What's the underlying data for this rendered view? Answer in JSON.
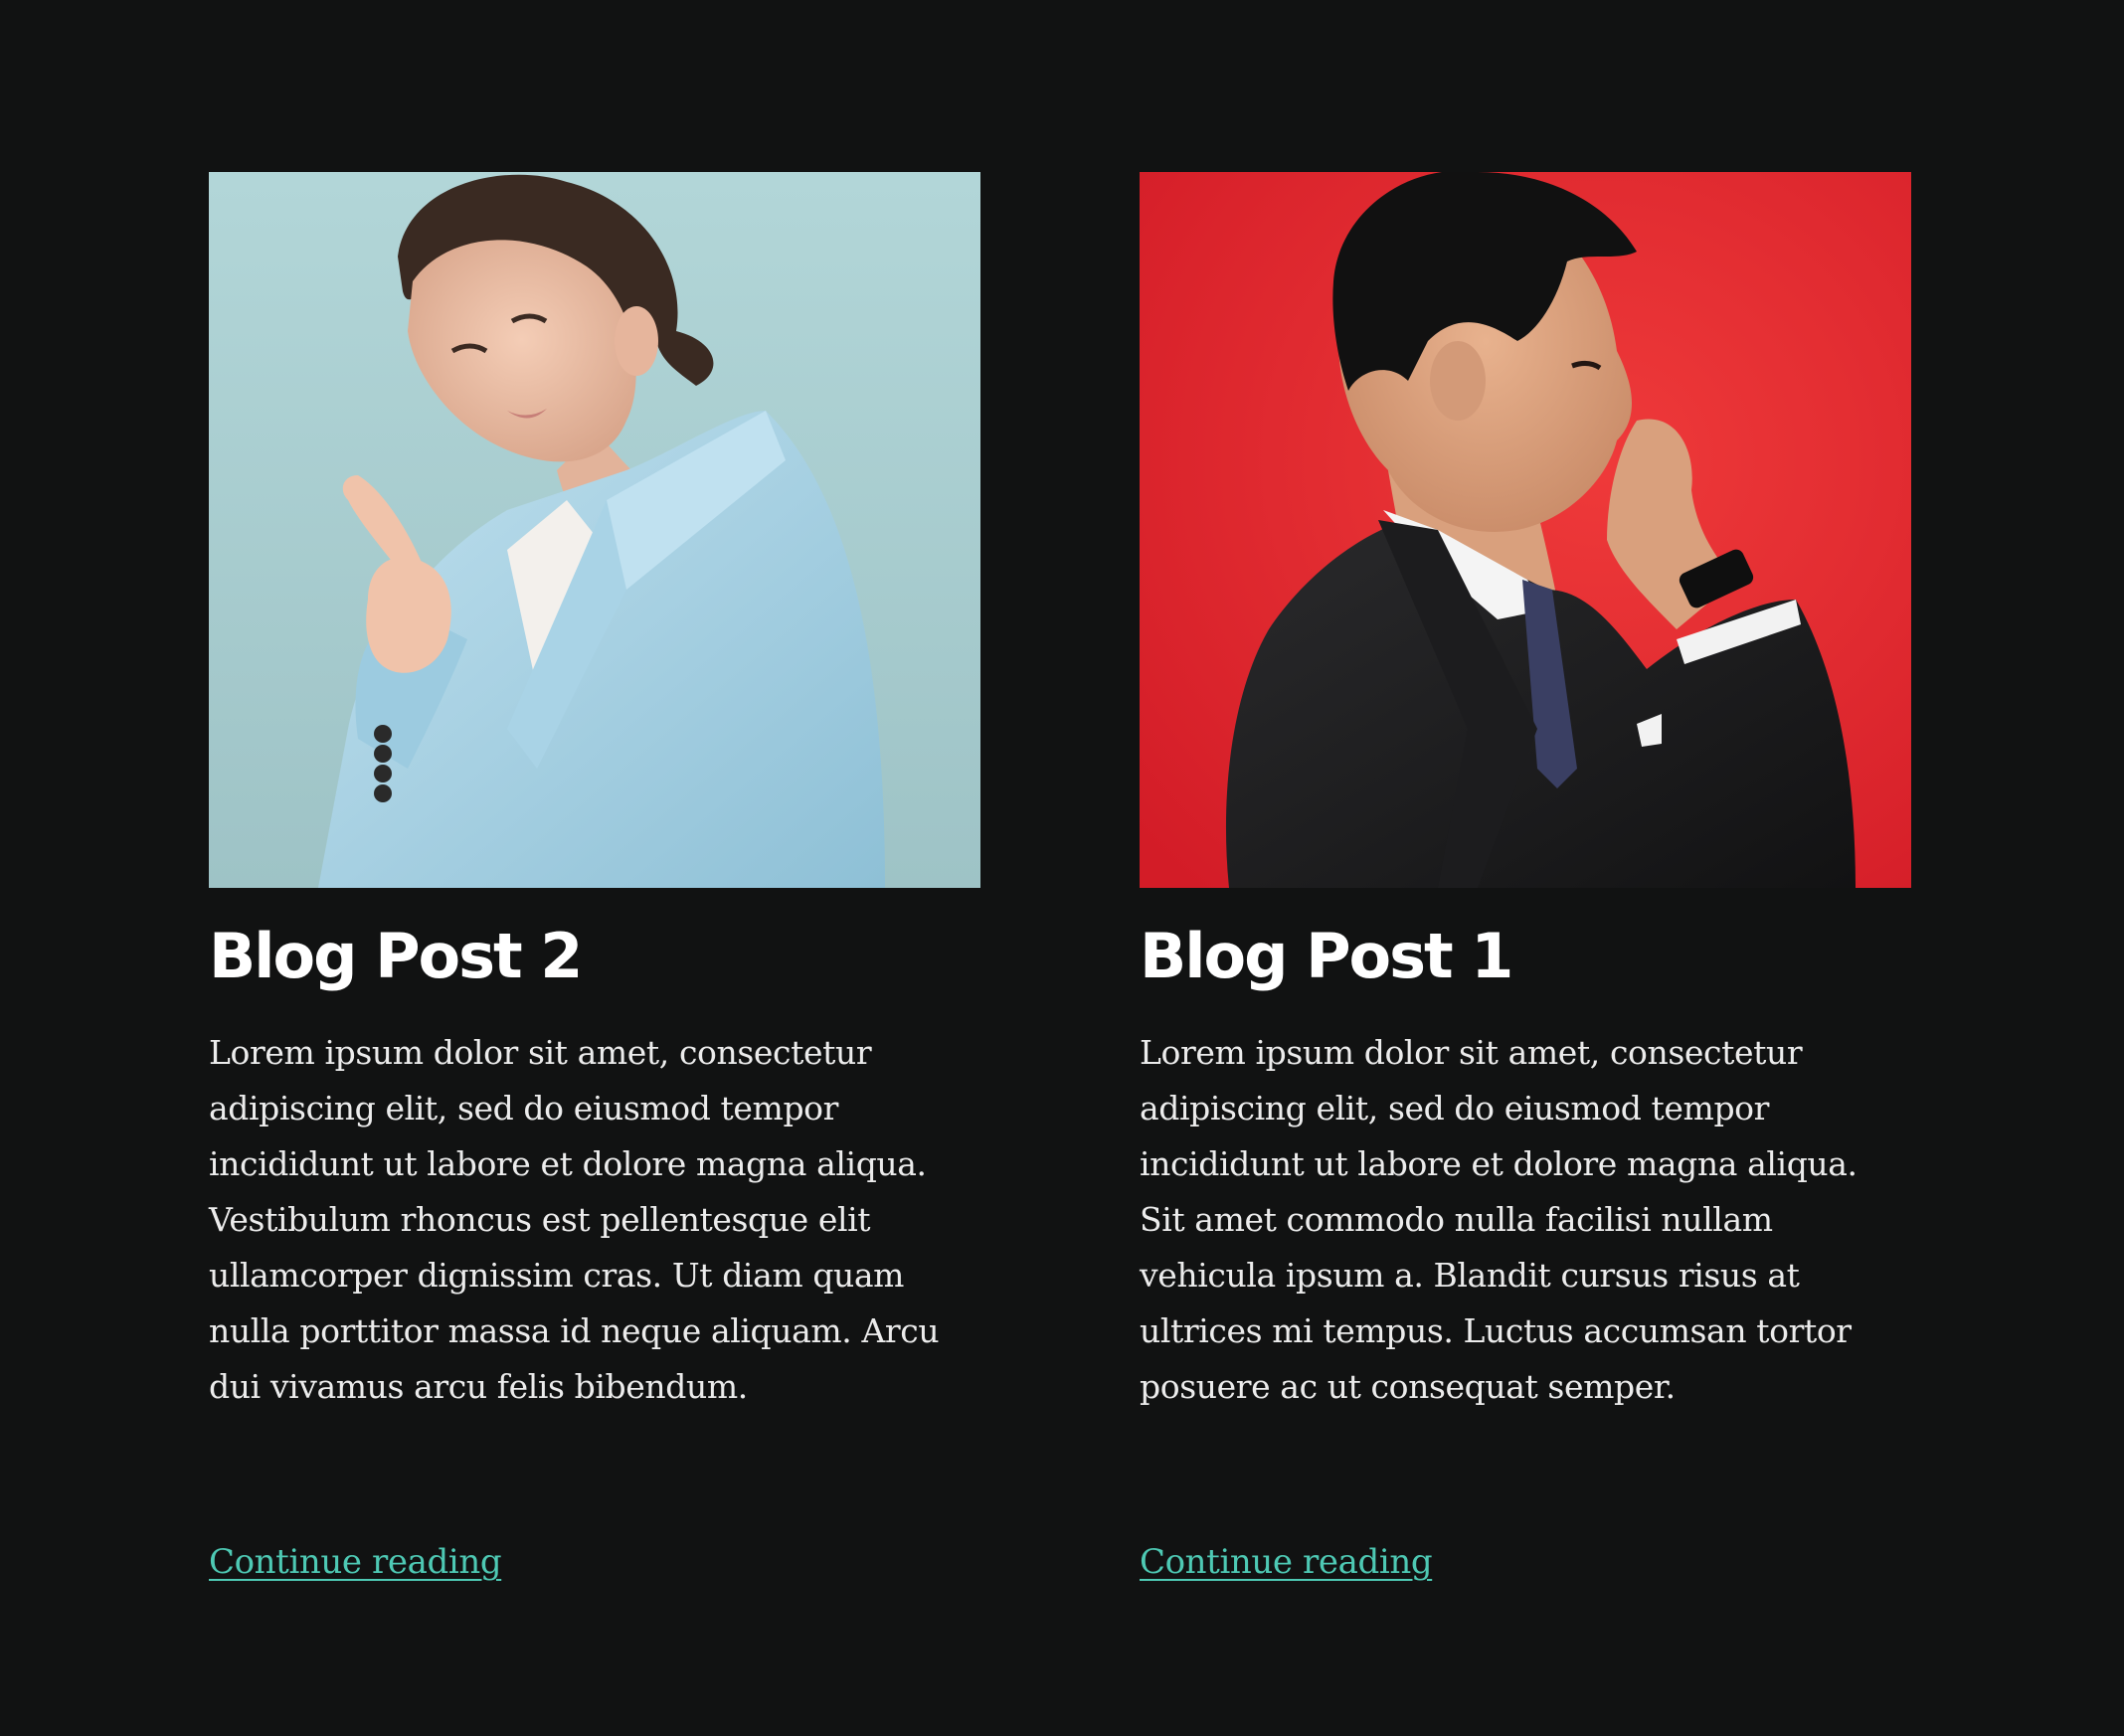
{
  "colors": {
    "background": "#111212",
    "title": "#ffffff",
    "body_text": "#ececec",
    "link": "#4ec9b4"
  },
  "posts": [
    {
      "title": "Blog Post 2",
      "image_alt": "woman-in-light-blue-blazer-pointing-image",
      "excerpt": "Lorem ipsum dolor sit amet, consectetur adipiscing elit, sed do eiusmod tempor incididunt ut labore et dolore magna aliqua. Vestibulum rhoncus est pellentesque elit ullamcorper dignissim cras. Ut diam quam nulla porttitor massa id neque aliquam. Arcu dui vivamus arcu felis bibendum.",
      "link_label": "Continue reading"
    },
    {
      "title": "Blog Post 1",
      "image_alt": "man-in-black-suit-on-phone-image",
      "excerpt": "Lorem ipsum dolor sit amet, consectetur adipiscing elit, sed do eiusmod tempor incididunt ut labore et dolore magna aliqua. Sit amet commodo nulla facilisi nullam vehicula ipsum a. Blandit cursus risus at ultrices mi tempus. Luctus accumsan tortor posuere ac ut consequat semper.",
      "link_label": "Continue reading"
    }
  ]
}
